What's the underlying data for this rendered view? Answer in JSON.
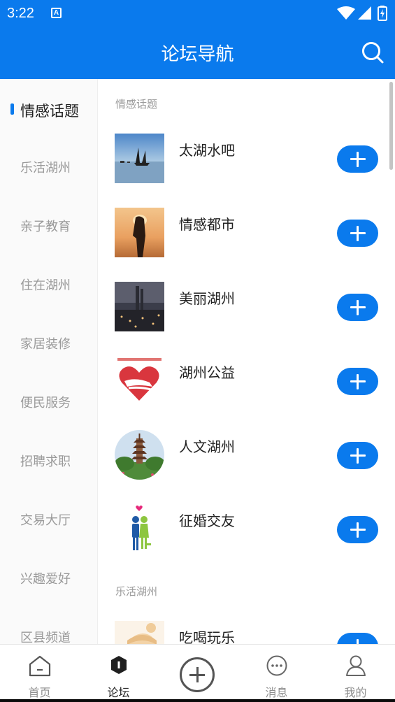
{
  "status_bar": {
    "time": "3:22",
    "notification_icon": "A"
  },
  "header": {
    "title": "论坛导航",
    "search_icon": "search-icon"
  },
  "sidebar": {
    "items": [
      {
        "label": "情感话题",
        "active": true
      },
      {
        "label": "乐活湖州",
        "active": false
      },
      {
        "label": "亲子教育",
        "active": false
      },
      {
        "label": "住在湖州",
        "active": false
      },
      {
        "label": "家居装修",
        "active": false
      },
      {
        "label": "便民服务",
        "active": false
      },
      {
        "label": "招聘求职",
        "active": false
      },
      {
        "label": "交易大厅",
        "active": false
      },
      {
        "label": "兴趣爱好",
        "active": false
      },
      {
        "label": "区县频道",
        "active": false
      }
    ]
  },
  "sections": [
    {
      "title": "情感话题",
      "forums": [
        {
          "name": "太湖水吧",
          "thumb": "lake-sailboats-image"
        },
        {
          "name": "情感都市",
          "thumb": "couple-sunset-image"
        },
        {
          "name": "美丽湖州",
          "thumb": "city-night-image"
        },
        {
          "name": "湖州公益",
          "thumb": "charity-heart-hands-image"
        },
        {
          "name": "人文湖州",
          "thumb": "pagoda-image"
        },
        {
          "name": "征婚交友",
          "thumb": "couple-cartoon-image"
        }
      ]
    },
    {
      "title": "乐活湖州",
      "forums": [
        {
          "name": "吃喝玩乐",
          "thumb": "cartoon-girl-image"
        }
      ]
    }
  ],
  "bottom_nav": {
    "tabs": [
      {
        "label": "首页",
        "icon": "home-icon",
        "active": false
      },
      {
        "label": "论坛",
        "icon": "forum-icon",
        "active": true
      },
      {
        "label": "",
        "icon": "add-post-icon",
        "active": false
      },
      {
        "label": "消息",
        "icon": "message-icon",
        "active": false
      },
      {
        "label": "我的",
        "icon": "profile-icon",
        "active": false
      }
    ]
  },
  "colors": {
    "accent": "#0a7aed",
    "inactive_text": "#9a9a9a",
    "active_text": "#1f1f1f"
  }
}
